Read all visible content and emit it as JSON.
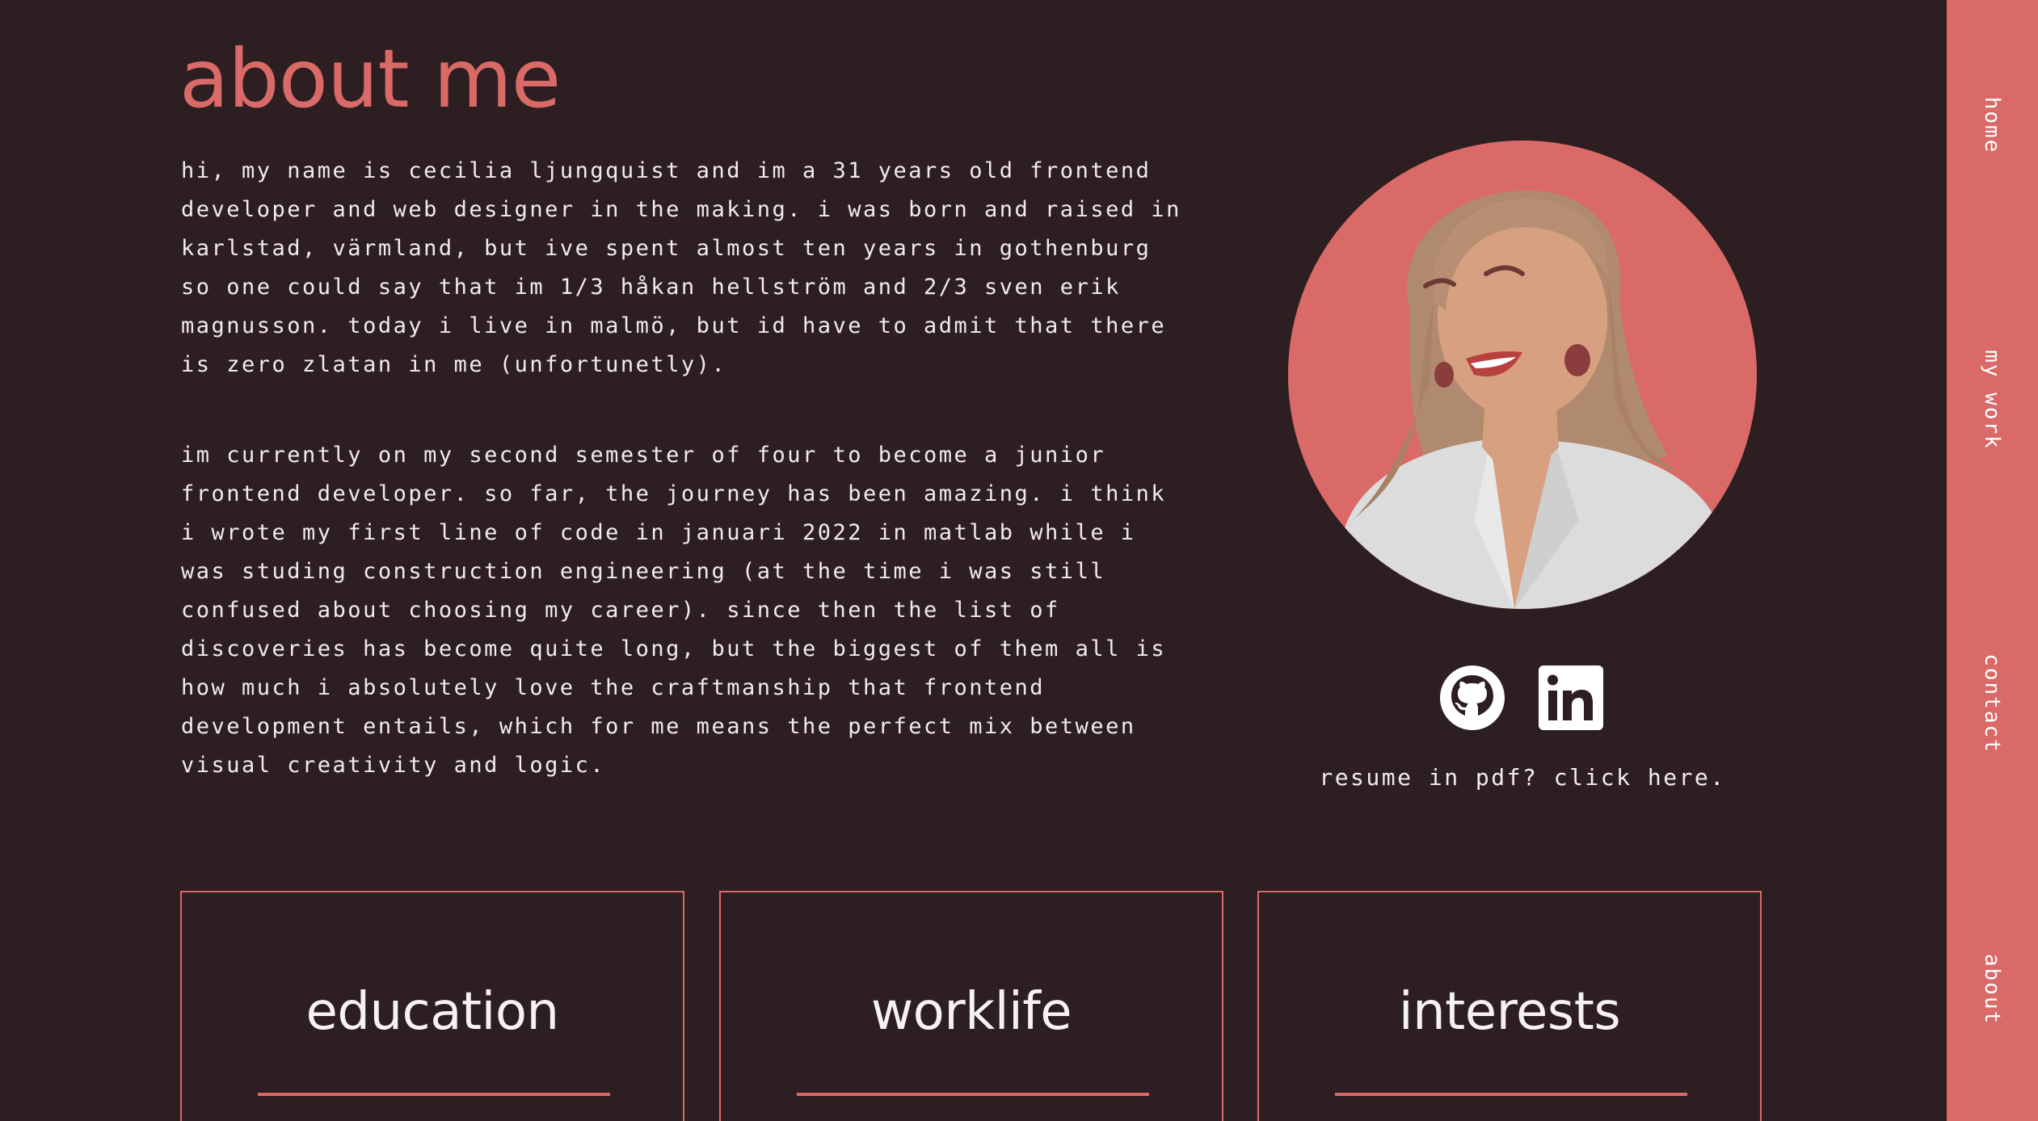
{
  "page": {
    "title": "about me",
    "bio_paragraphs": [
      "hi, my name is cecilia ljungquist and im a 31 years old frontend\ndeveloper and web designer in the making. i was born and raised in\nkarlstad, värmland, but ive spent almost ten years in gothenburg\nso one could say that im 1/3 håkan hellström and 2/3 sven erik\nmagnusson. today i live in malmö, but id have to admit that there\nis zero zlatan in me (unfortunetly).",
      "im currently on my second semester of four to become a junior\nfrontend developer. so far, the journey has been amazing. i think\ni wrote my first line of code in januari 2022 in matlab while i\nwas studing construction engineering (at the time i was still\nconfused about choosing my career). since then the list of\ndiscoveries has become quite long, but the biggest of them all is\nhow much i absolutely love the craftmanship that frontend\ndevelopment entails, which for me means the perfect mix between\nvisual creativity and logic."
    ],
    "resume_link": "resume in pdf? click here.",
    "socials": [
      {
        "icon": "github-icon"
      },
      {
        "icon": "linkedin-icon"
      }
    ],
    "cards": [
      {
        "title": "education"
      },
      {
        "title": "worklife"
      },
      {
        "title": "interests"
      }
    ]
  },
  "nav": {
    "items": [
      "home",
      "my work",
      "contact",
      "about"
    ]
  },
  "colors": {
    "background": "#2d1f21",
    "accent": "#d96a68",
    "text": "#f1ecec"
  }
}
